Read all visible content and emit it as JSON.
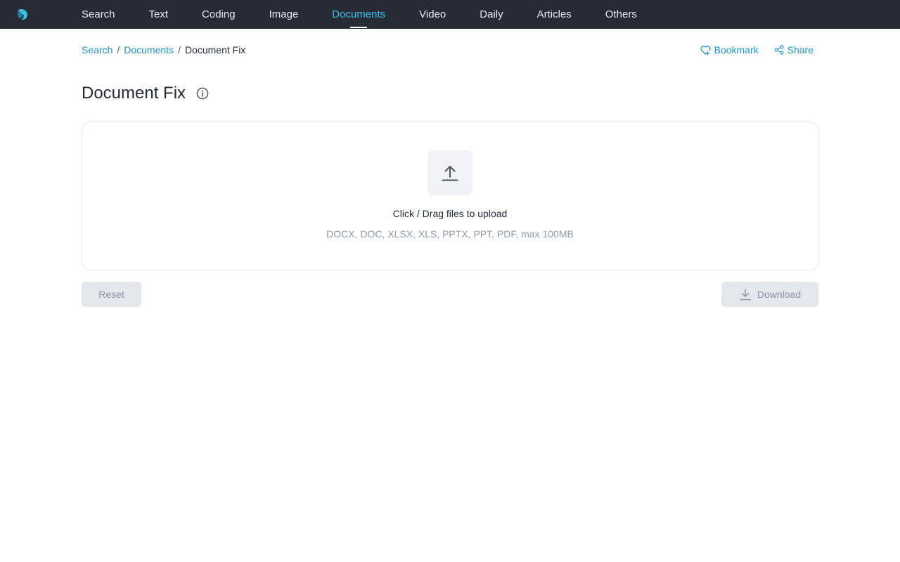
{
  "nav": {
    "items": [
      {
        "label": "Search",
        "active": false
      },
      {
        "label": "Text",
        "active": false
      },
      {
        "label": "Coding",
        "active": false
      },
      {
        "label": "Image",
        "active": false
      },
      {
        "label": "Documents",
        "active": true
      },
      {
        "label": "Video",
        "active": false
      },
      {
        "label": "Daily",
        "active": false
      },
      {
        "label": "Articles",
        "active": false
      },
      {
        "label": "Others",
        "active": false
      }
    ]
  },
  "breadcrumb": {
    "items": [
      "Search",
      "Documents"
    ],
    "separator": "/",
    "current": "Document Fix"
  },
  "actions": {
    "bookmark_label": "Bookmark",
    "share_label": "Share"
  },
  "page": {
    "title": "Document Fix"
  },
  "upload": {
    "prompt": "Click / Drag files to upload",
    "hint": "DOCX, DOC, XLSX, XLS, PPTX, PPT, PDF, max 100MB"
  },
  "buttons": {
    "reset_label": "Reset",
    "download_label": "Download"
  },
  "colors": {
    "nav_bg": "#262b36",
    "accent": "#1b95c9",
    "nav_active": "#38c3ec",
    "button_disabled_bg": "#e3e6eb"
  },
  "icons": [
    "logo-icon",
    "heart-icon",
    "share-icon",
    "info-icon",
    "upload-icon",
    "download-icon"
  ]
}
